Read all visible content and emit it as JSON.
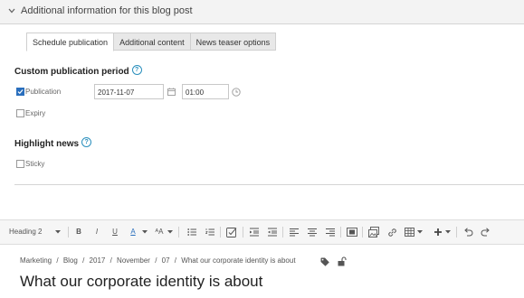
{
  "section": {
    "title": "Additional information for this blog post"
  },
  "tabs": [
    {
      "label": "Schedule publication",
      "active": true
    },
    {
      "label": "Additional content",
      "active": false
    },
    {
      "label": "News teaser options",
      "active": false
    }
  ],
  "publication": {
    "heading": "Custom publication period",
    "publication_label": "Publication",
    "publication_checked": true,
    "date_value": "2017-11-07",
    "time_value": "01:00",
    "expiry_label": "Expiry",
    "expiry_checked": false
  },
  "highlight": {
    "heading": "Highlight news",
    "sticky_label": "Sticky",
    "sticky_checked": false
  },
  "toolbar": {
    "style_label": "Heading 2",
    "bold": "B",
    "italic": "I",
    "underline": "U",
    "font_color": "A",
    "font_size": "ᴬA"
  },
  "breadcrumb": [
    "Marketing",
    "/",
    "Blog",
    "/",
    "2017",
    "/",
    "November",
    "/",
    "07",
    "/",
    "What our corporate identity is about"
  ],
  "page_title": "What our corporate identity is about",
  "colors": {
    "accent": "#2a6fbd",
    "help": "#2a8fbd"
  }
}
